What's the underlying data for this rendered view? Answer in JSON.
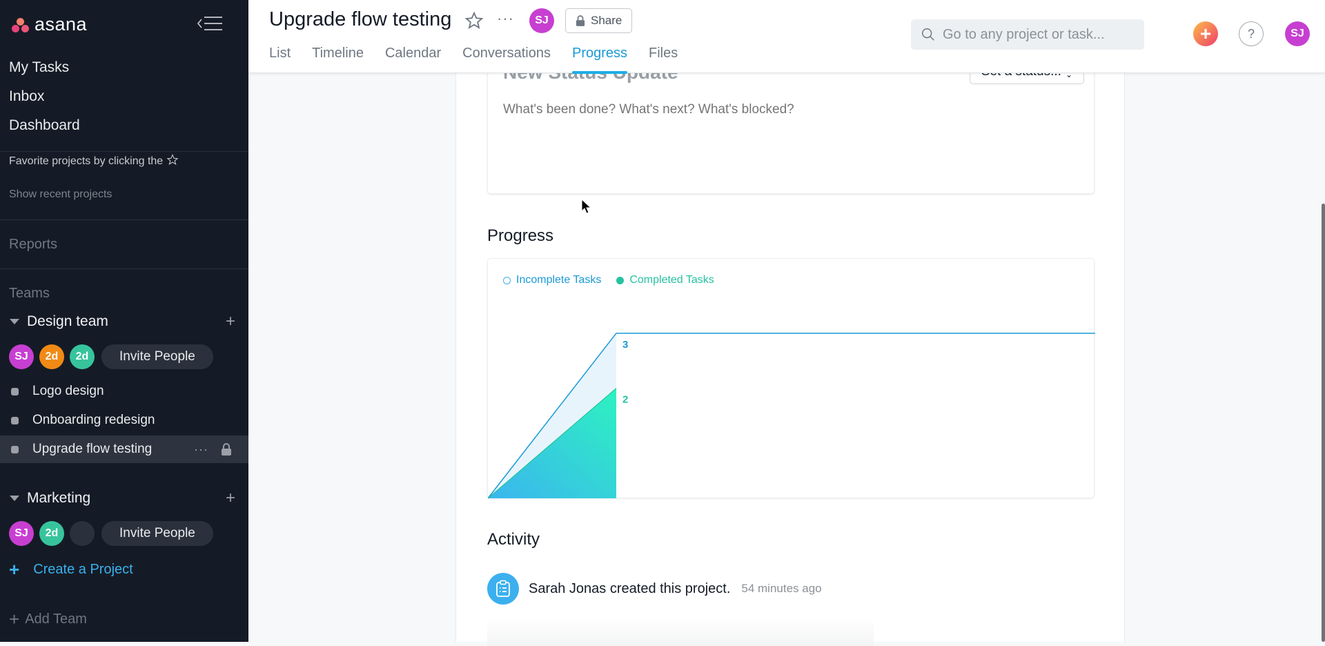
{
  "sidebar": {
    "logo_text": "asana",
    "nav": [
      "My Tasks",
      "Inbox",
      "Dashboard"
    ],
    "favorites_hint": "Favorite projects by clicking the",
    "show_recent": "Show recent projects",
    "reports": "Reports",
    "teams_label": "Teams",
    "teams": [
      {
        "name": "Design team",
        "members": [
          {
            "initials": "SJ",
            "color": "#c73fd1"
          },
          {
            "initials": "2d",
            "color": "#f08a15"
          },
          {
            "initials": "2d",
            "color": "#37c49c"
          }
        ],
        "invite_label": "Invite People",
        "projects": [
          {
            "name": "Logo design",
            "active": false
          },
          {
            "name": "Onboarding redesign",
            "active": false
          },
          {
            "name": "Upgrade flow testing",
            "active": true
          }
        ]
      },
      {
        "name": "Marketing",
        "members": [
          {
            "initials": "SJ",
            "color": "#c73fd1"
          },
          {
            "initials": "2d",
            "color": "#37c49c"
          },
          {
            "initials": "",
            "color": "#2b313c"
          }
        ],
        "invite_label": "Invite People",
        "projects": []
      }
    ],
    "create_project": "Create a Project",
    "add_team": "Add Team"
  },
  "header": {
    "project_title": "Upgrade flow testing",
    "owner_initials": "SJ",
    "share_label": "Share",
    "tabs": [
      {
        "label": "List",
        "active": false
      },
      {
        "label": "Timeline",
        "active": false
      },
      {
        "label": "Calendar",
        "active": false
      },
      {
        "label": "Conversations",
        "active": false
      },
      {
        "label": "Progress",
        "active": true
      },
      {
        "label": "Files",
        "active": false
      }
    ],
    "search_placeholder": "Go to any project or task...",
    "quick_add": "+",
    "help": "?",
    "user_initials": "SJ"
  },
  "status_update": {
    "title": "New Status Update",
    "set_status_label": "Set a status...",
    "placeholder": "What's been done? What's next? What's blocked?"
  },
  "progress": {
    "heading": "Progress",
    "legend": [
      {
        "label": "Incomplete Tasks",
        "color": "#1a9ad6"
      },
      {
        "label": "Completed Tasks",
        "color": "#25c2a0"
      }
    ]
  },
  "chart_data": {
    "type": "area",
    "title": "Progress",
    "x": [
      0,
      1,
      4
    ],
    "series": [
      {
        "name": "Incomplete Tasks",
        "values": [
          0,
          3,
          3
        ],
        "color": "#1a9ad6"
      },
      {
        "name": "Completed Tasks",
        "values": [
          0,
          2,
          null
        ],
        "color": "#25c2a0"
      }
    ],
    "data_labels": [
      {
        "series": "Incomplete Tasks",
        "x": 1,
        "value": 3
      },
      {
        "series": "Completed Tasks",
        "x": 1,
        "value": 2
      }
    ],
    "ylim": [
      0,
      3.6
    ],
    "grid": false,
    "legend": "top-left"
  },
  "activity": {
    "heading": "Activity",
    "items": [
      {
        "actor": "Sarah Jonas",
        "action": "created this project.",
        "time": "54 minutes ago"
      }
    ]
  }
}
